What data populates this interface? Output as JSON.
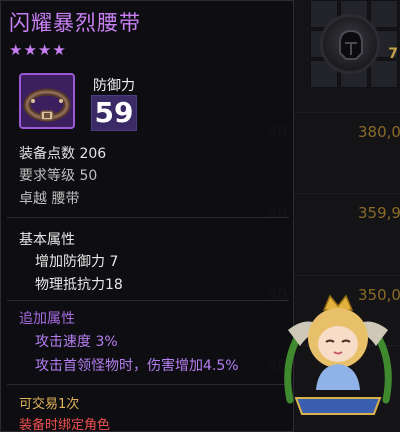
{
  "background": {
    "rows": [
      {
        "name": "",
        "level": "50",
        "price": "380,0"
      },
      {
        "name": "",
        "level": "50",
        "price": "359,9"
      },
      {
        "name": "",
        "level": "50",
        "price": "350,0"
      },
      {
        "name": "",
        "level": "50",
        "price": ""
      }
    ],
    "badge": "7"
  },
  "item": {
    "name": "闪耀暴烈腰带",
    "stars": "★★★★",
    "defense_label": "防御力",
    "defense_value": "59",
    "equip_points": "装备点数 206",
    "required_level": "要求等级 50",
    "grade_type": "卓越 腰带",
    "base_title": "基本属性",
    "base_attrs": [
      "增加防御力 7",
      "物理抵抗力18"
    ],
    "extra_title": "追加属性",
    "extra_attrs": [
      "攻击速度 3%",
      "攻击首领怪物时，伤害增加4.5%"
    ],
    "tradable": "可交易1次",
    "bind_note": "装备时绑定角色"
  },
  "colors": {
    "title": "#c77ff3",
    "extra": "#b57ef0",
    "trade": "#e1b45a",
    "bind": "#ef4f4f"
  },
  "icons": [
    "belt-icon",
    "helmet-icon",
    "mascot-emblem"
  ]
}
